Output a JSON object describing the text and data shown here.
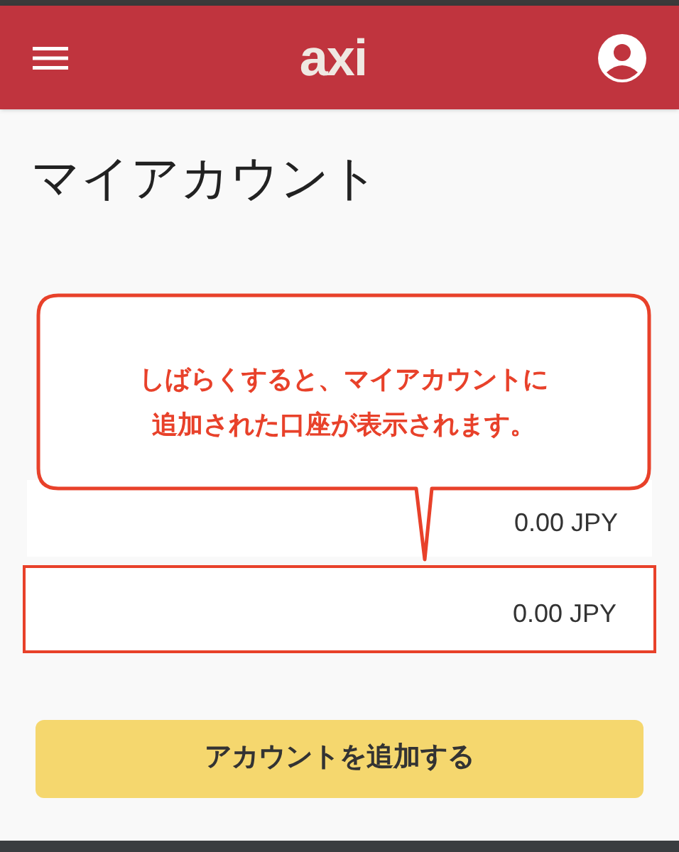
{
  "header": {
    "logo": "axi"
  },
  "title": "マイアカウント",
  "callout": {
    "lines": [
      "しばらくすると、マイアカウントに",
      "追加された口座が表示されます。"
    ]
  },
  "accounts": [
    {
      "balance": "0.00 JPY",
      "highlighted": false
    },
    {
      "balance": "0.00 JPY",
      "highlighted": true
    }
  ],
  "add_button": {
    "label": "アカウントを追加する"
  }
}
